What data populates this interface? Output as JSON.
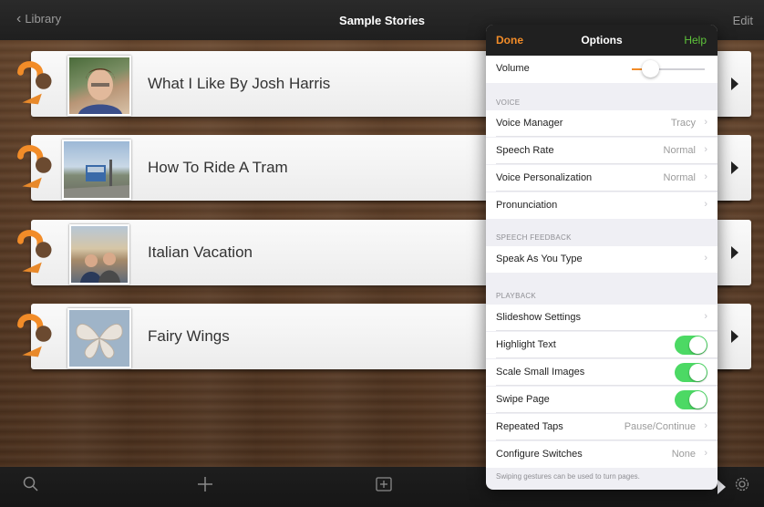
{
  "nav": {
    "back_label": "Library",
    "title": "Sample Stories",
    "edit_label": "Edit"
  },
  "stories": [
    {
      "title": "What I Like By Josh Harris"
    },
    {
      "title": "How To Ride A Tram"
    },
    {
      "title": "Italian Vacation"
    },
    {
      "title": "Fairy Wings"
    }
  ],
  "toolbar": {
    "icons": [
      "search-icon",
      "plus-icon",
      "add-page-icon",
      "gear-icon"
    ]
  },
  "options": {
    "done_label": "Done",
    "title": "Options",
    "help_label": "Help",
    "volume_label": "Volume",
    "volume_level": 0.25,
    "voice_section": "VOICE",
    "voice_manager": {
      "label": "Voice Manager",
      "value": "Tracy"
    },
    "speech_rate": {
      "label": "Speech Rate",
      "value": "Normal"
    },
    "voice_personalization": {
      "label": "Voice Personalization",
      "value": "Normal"
    },
    "pronunciation": {
      "label": "Pronunciation"
    },
    "feedback_section": "SPEECH FEEDBACK",
    "speak_as_you_type": {
      "label": "Speak As You Type"
    },
    "playback_section": "PLAYBACK",
    "slideshow_settings": {
      "label": "Slideshow Settings"
    },
    "highlight_text": {
      "label": "Highlight Text",
      "on": true
    },
    "scale_small_images": {
      "label": "Scale Small Images",
      "on": true
    },
    "swipe_page": {
      "label": "Swipe Page",
      "on": true
    },
    "repeated_taps": {
      "label": "Repeated Taps",
      "value": "Pause/Continue"
    },
    "configure_switches": {
      "label": "Configure Switches",
      "value": "None"
    },
    "footnote": "Swiping gestures can be used to turn pages."
  },
  "colors": {
    "accent": "#f28c28",
    "help": "#5ec43a",
    "toggle_on": "#4cd964"
  }
}
